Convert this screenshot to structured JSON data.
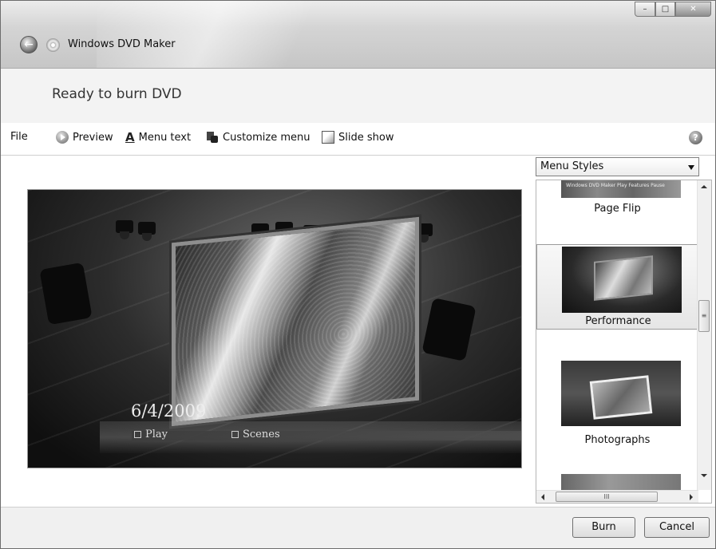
{
  "window": {
    "title": "Windows DVD Maker"
  },
  "header": {
    "title": "Ready to burn DVD"
  },
  "toolbar": {
    "file": "File",
    "preview": "Preview",
    "menu_text": "Menu text",
    "customize_menu": "Customize menu",
    "slide_show": "Slide show",
    "help_icon": "?"
  },
  "preview": {
    "date": "6/4/2009",
    "play": "Play",
    "scenes": "Scenes"
  },
  "menu_styles": {
    "selected": "Menu Styles",
    "items": [
      {
        "label": "Page Flip",
        "thumb_caption": "Windows DVD Maker  Play  Features  Pause",
        "selected": false
      },
      {
        "label": "Performance",
        "selected": true
      },
      {
        "label": "Photographs",
        "selected": false
      }
    ],
    "scroll_grip": "≡",
    "hscroll_grip": "III"
  },
  "footer": {
    "burn": "Burn",
    "cancel": "Cancel"
  }
}
